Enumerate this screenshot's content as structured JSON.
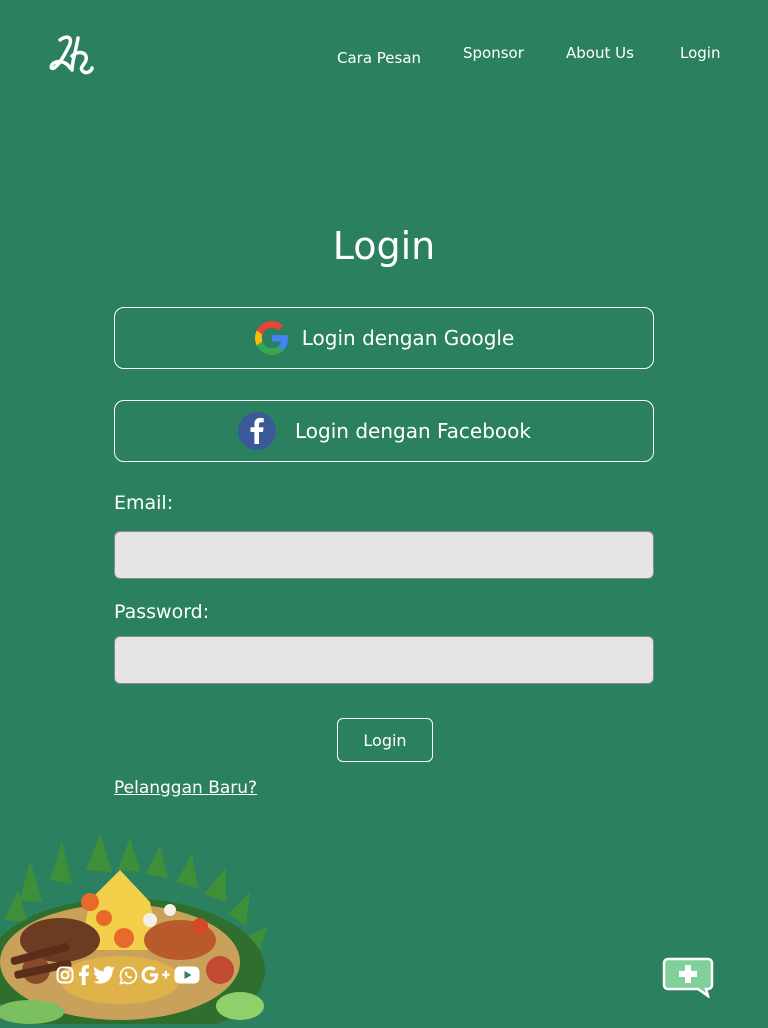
{
  "brand": {
    "logo_icon": "script-logo-icon",
    "background_color": "#2b8060"
  },
  "nav": {
    "items": [
      {
        "label": "Cara Pesan"
      },
      {
        "label": "Sponsor"
      },
      {
        "label": "About Us"
      },
      {
        "label": "Login"
      }
    ]
  },
  "page": {
    "title": "Login"
  },
  "social_login": {
    "google_label": "Login dengan Google",
    "facebook_label": "Login dengan Facebook",
    "google_icon": "google-icon",
    "facebook_icon": "facebook-icon"
  },
  "form": {
    "email_label": "Email:",
    "email_value": "",
    "password_label": "Password:",
    "password_value": "",
    "submit_label": "Login",
    "new_customer_link": "Pelanggan Baru?"
  },
  "footer": {
    "social_icons": [
      "instagram-icon",
      "facebook-icon",
      "twitter-icon",
      "whatsapp-icon",
      "google-plus-icon",
      "youtube-icon"
    ],
    "chat_icon": "chat-plus-icon",
    "illustration": "tumpeng-food-illustration"
  }
}
